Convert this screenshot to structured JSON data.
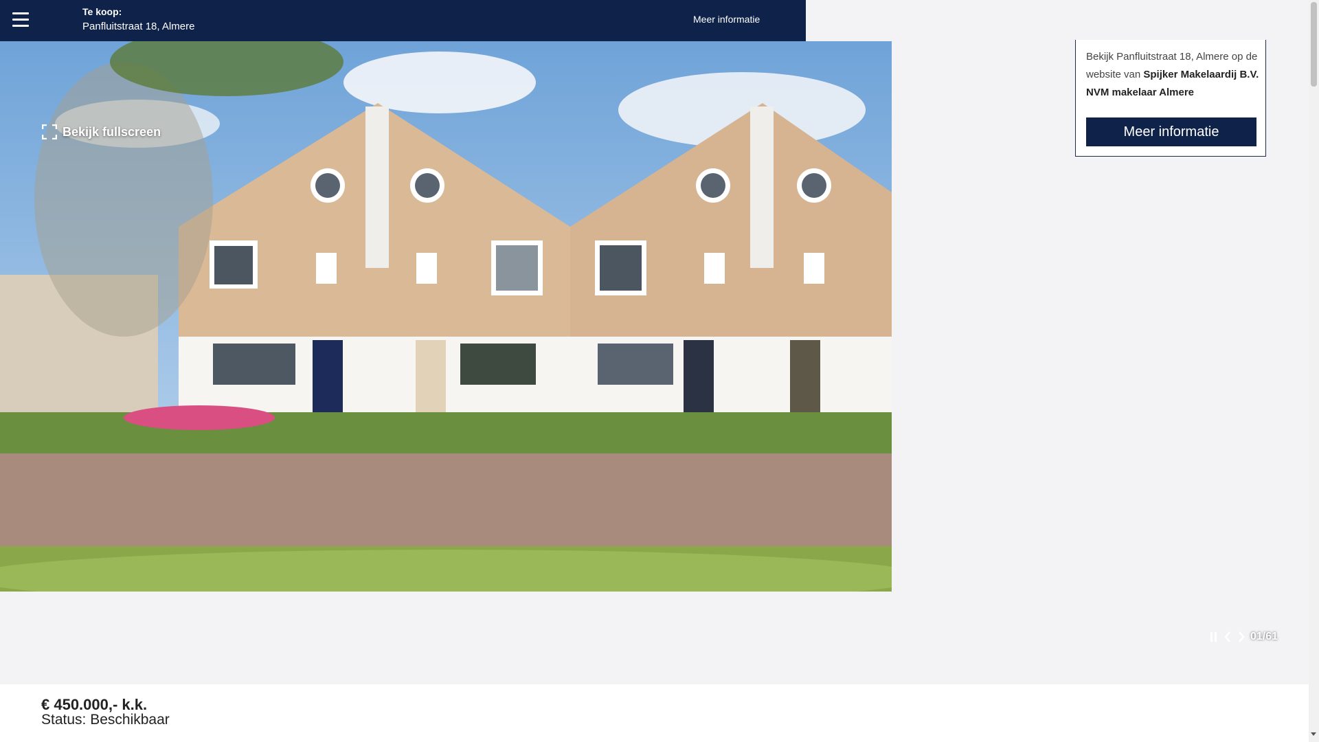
{
  "topbar": {
    "title": "Te koop:",
    "address": "Panfluitstraat 18, Almere",
    "more_label": "Meer informatie"
  },
  "hero": {
    "fullscreen_label": "Bekijk fullscreen",
    "counter": "01/61"
  },
  "card": {
    "text_before": "Bekijk Panfluitstraat 18, Almere op de website van ",
    "agency": "Spijker Makelaardij B.V. NVM makelaar Almere",
    "button_label": "Meer informatie"
  },
  "listing": {
    "price": "€ 450.000,- k.k.",
    "status": "Status: Beschikbaar"
  },
  "colors": {
    "navy": "#0f2249",
    "background": "#f3f3f5"
  }
}
